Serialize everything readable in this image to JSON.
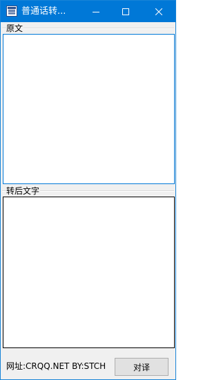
{
  "window": {
    "title": "普通话转...",
    "accent_color": "#0078d7"
  },
  "titlebar": {
    "app_icon": "app-icon",
    "minimize_icon": "minimize-icon",
    "maximize_icon": "maximize-icon",
    "close_icon": "close-icon"
  },
  "source_group": {
    "label": "原文",
    "value": ""
  },
  "result_group": {
    "label": "转后文字",
    "value": ""
  },
  "footer": {
    "website_text": "网址:CRQQ.NET BY:STCH",
    "translate_label": "对译"
  }
}
